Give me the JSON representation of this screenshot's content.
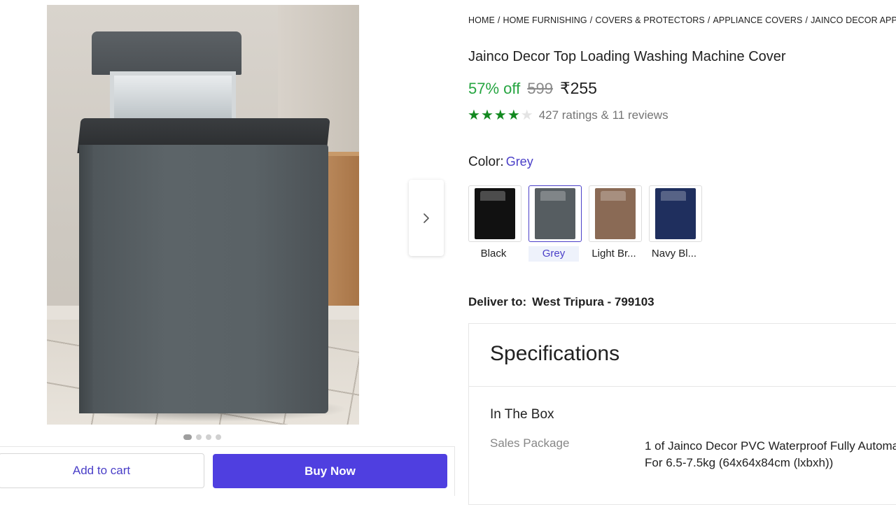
{
  "gallery": {
    "dots": [
      true,
      false,
      false,
      false
    ],
    "next_icon": "chevron-right-icon"
  },
  "actions": {
    "add_to_cart": "Add to cart",
    "buy_now": "Buy Now",
    "buy_color": "#4f3fe0"
  },
  "breadcrumb": [
    "HOME",
    "HOME FURNISHING",
    "COVERS & PROTECTORS",
    "APPLIANCE COVERS",
    "JAINCO DECOR APPLIAN"
  ],
  "product": {
    "title": "Jainco Decor Top Loading Washing Machine  Cover",
    "discount": "57% off",
    "mrp": "599",
    "price": "₹255",
    "rating_stars": 4,
    "rating_max": 5,
    "ratings_text": "427 ratings  & 11 reviews",
    "star_color": "#12891f",
    "discount_color": "#26a541"
  },
  "color": {
    "label": "Color:",
    "selected": "Grey",
    "options": [
      {
        "name": "Black",
        "swatch": "#111111",
        "selected": false
      },
      {
        "name": "Grey",
        "swatch": "#565d61",
        "selected": true
      },
      {
        "name": "Light Br...",
        "swatch": "#8a6a55",
        "selected": false
      },
      {
        "name": "Navy Bl...",
        "swatch": "#1f2f5e",
        "selected": false
      }
    ]
  },
  "delivery": {
    "label": "Deliver to:",
    "location": "West Tripura - 799103"
  },
  "specs": {
    "title": "Specifications",
    "section": "In The Box",
    "rows": [
      {
        "key": "Sales Package",
        "value_line1": "1 of Jainco Decor PVC Waterproof Fully Automa",
        "value_line2": "For 6.5-7.5kg (64x64x84cm (lxbxh))"
      }
    ]
  }
}
